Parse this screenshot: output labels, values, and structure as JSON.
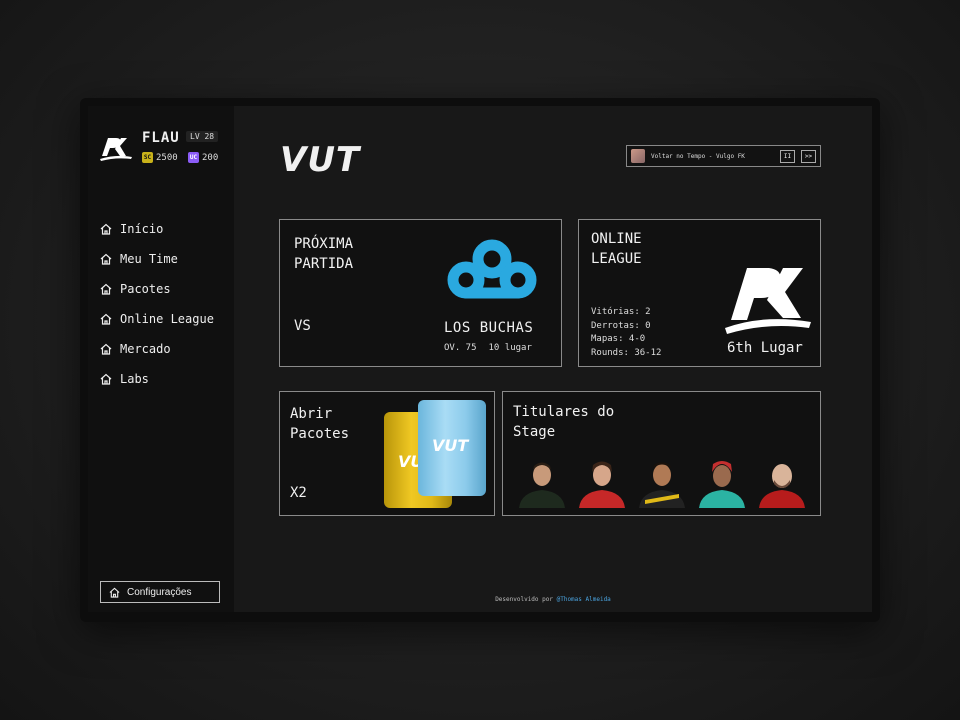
{
  "profile": {
    "name": "FLAU",
    "level": "LV 28",
    "currency": [
      {
        "code": "SC",
        "amount": "2500",
        "color": "#c8b21a"
      },
      {
        "code": "UC",
        "amount": "200",
        "color": "#8b5cf6"
      }
    ]
  },
  "nav": {
    "items": [
      {
        "label": "Início",
        "icon": "home-icon"
      },
      {
        "label": "Meu Time",
        "icon": "home-icon"
      },
      {
        "label": "Pacotes",
        "icon": "home-icon"
      },
      {
        "label": "Online League",
        "icon": "home-icon"
      },
      {
        "label": "Mercado",
        "icon": "home-icon"
      },
      {
        "label": "Labs",
        "icon": "home-icon"
      }
    ],
    "settings_label": "Configurações"
  },
  "header": {
    "title": "VUT"
  },
  "music_player": {
    "track": "Voltar no Tempo - Vulgo FK",
    "pause_label": "II",
    "skip_label": ">>"
  },
  "next_match": {
    "title": "PRÓXIMA\nPARTIDA",
    "vs_label": "VS",
    "opponent": "LOS BUCHAS",
    "overall": "OV. 75",
    "position": "10 lugar",
    "opponent_color": "#2aa9e0"
  },
  "online_league": {
    "title": "ONLINE\nLEAGUE",
    "stats": [
      "Vitórias: 2",
      "Derrotas: 0",
      "Mapas: 4-0",
      "Rounds: 36-12"
    ],
    "place": "6th Lugar"
  },
  "packs": {
    "title": "Abrir\nPacotes",
    "count": "X2",
    "pack_label": "VUT"
  },
  "stage": {
    "title": "Titulares do\nStage",
    "players": [
      {
        "jersey": "#1e2a1e",
        "skin": "#c89a7a"
      },
      {
        "jersey": "#c62828",
        "skin": "#d6a68a"
      },
      {
        "jersey": "#222222",
        "skin": "#b07a55"
      },
      {
        "jersey": "#2bb3a3",
        "skin": "#9a6a4e"
      },
      {
        "jersey": "#b71c1c",
        "skin": "#d9b49a"
      }
    ]
  },
  "footer": {
    "prefix": "Desenvolvido por",
    "author": "@Thomas Almeida"
  }
}
